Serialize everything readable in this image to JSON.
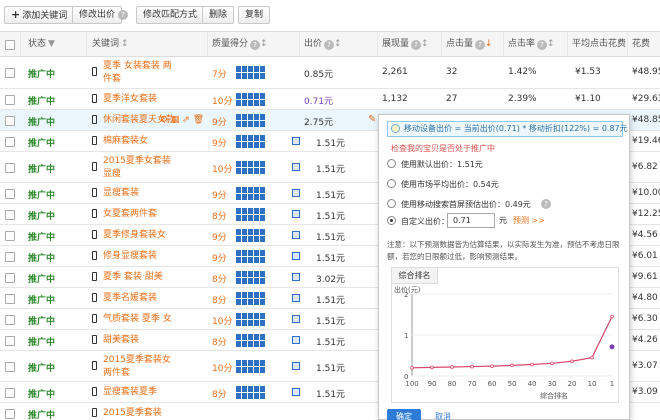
{
  "toolbar": {
    "add_keyword": "添加关键词",
    "modify_bid": "修改出价",
    "modify_match": "修改匹配方式",
    "delete": "删除",
    "copy": "复制"
  },
  "columns": {
    "status": "状态",
    "keyword": "关键词",
    "quality": "质量得分",
    "bid": "出价",
    "impressions": "展现量",
    "clicks": "点击量",
    "ctr": "点击率",
    "avg_cpc": "平均点击花费",
    "cost": "花费"
  },
  "rows": [
    {
      "status": "推广中",
      "keyword": "夏季 女装套装 两件套",
      "score": "7分",
      "bid": "0.85元",
      "impressions": "2,261",
      "clicks": "32",
      "ctr": "1.42%",
      "cpc": "¥1.53",
      "cost": "¥48.95"
    },
    {
      "status": "推广中",
      "keyword": "夏季洋女套装",
      "score": "10分",
      "bid": "0.71元",
      "impressions": "1,132",
      "clicks": "27",
      "ctr": "2.39%",
      "cpc": "¥1.10",
      "cost": "¥29.63"
    },
    {
      "status": "推广中",
      "keyword": "休闲套装夏天女款",
      "score": "9分",
      "bid": "2.75元",
      "impressions": "",
      "clicks": "",
      "ctr": "",
      "cpc": "",
      "cost": "¥48.85"
    },
    {
      "status": "推广中",
      "keyword": "棉麻套装女",
      "score": "9分",
      "bid": "1.51元",
      "impressions": "",
      "clicks": "",
      "ctr": "",
      "cpc": "",
      "cost": "¥19.46"
    },
    {
      "status": "推广中",
      "keyword": "2015夏季女套装显瘦",
      "score": "10分",
      "bid": "1.51元",
      "impressions": "",
      "clicks": "",
      "ctr": "",
      "cpc": "",
      "cost": "¥6.82"
    },
    {
      "status": "推广中",
      "keyword": "显瘦套装",
      "score": "9分",
      "bid": "1.51元",
      "impressions": "",
      "clicks": "",
      "ctr": "",
      "cpc": "",
      "cost": "¥10.00"
    },
    {
      "status": "推广中",
      "keyword": "女夏套两件套",
      "score": "8分",
      "bid": "1.51元",
      "impressions": "",
      "clicks": "",
      "ctr": "",
      "cpc": "",
      "cost": "¥12.25"
    },
    {
      "status": "推广中",
      "keyword": "夏季修身套装女",
      "score": "9分",
      "bid": "1.51元",
      "impressions": "",
      "clicks": "",
      "ctr": "",
      "cpc": "",
      "cost": "¥4.56"
    },
    {
      "status": "推广中",
      "keyword": "修身显瘦套装",
      "score": "9分",
      "bid": "1.51元",
      "impressions": "",
      "clicks": "",
      "ctr": "",
      "cpc": "",
      "cost": "¥6.01"
    },
    {
      "status": "推广中",
      "keyword": "夏季 套装 甜美",
      "score": "8分",
      "bid": "3.02元",
      "impressions": "",
      "clicks": "",
      "ctr": "",
      "cpc": "",
      "cost": "¥9.61"
    },
    {
      "status": "推广中",
      "keyword": "夏季名媛套装",
      "score": "8分",
      "bid": "1.51元",
      "impressions": "",
      "clicks": "",
      "ctr": "",
      "cpc": "",
      "cost": "¥4.80"
    },
    {
      "status": "推广中",
      "keyword": "气质套装 夏季 女",
      "score": "10分",
      "bid": "1.51元",
      "impressions": "",
      "clicks": "",
      "ctr": "",
      "cpc": "",
      "cost": "¥6.30"
    },
    {
      "status": "推广中",
      "keyword": "甜美套装",
      "score": "8分",
      "bid": "1.51元",
      "impressions": "",
      "clicks": "",
      "ctr": "",
      "cpc": "",
      "cost": "¥4.26"
    },
    {
      "status": "推广中",
      "keyword": "2015夏季套装女两件套",
      "score": "10分",
      "bid": "1.51元",
      "impressions": "",
      "clicks": "",
      "ctr": "",
      "cpc": "",
      "cost": "¥3.07"
    },
    {
      "status": "推广中",
      "keyword": "显瘦套装夏季",
      "score": "8分",
      "bid": "1.51元",
      "impressions": "",
      "clicks": "",
      "ctr": "",
      "cpc": "",
      "cost": "¥3.09"
    },
    {
      "status": "推广中",
      "keyword": "2015夏季套装",
      "score": "",
      "bid": "",
      "impressions": "",
      "clicks": "",
      "ctr": "",
      "cpc": "",
      "cost": ""
    }
  ],
  "popup": {
    "formula": "移动设备出价 = 当前出价(0.71) * 移动折扣(122%) = 0.87元",
    "check_link": "检查我的宝贝是否处于推广中",
    "opt_default": "使用默认出价：1.51元",
    "opt_market": "使用市场平均出价：0.54元",
    "opt_mobile": "使用移动搜索首屏预估出价：0.49元",
    "opt_custom": "自定义出价：",
    "custom_value": "0.71",
    "unit": "元",
    "predict": "预测 >>",
    "note": "注意：以下预测数据皆为估算结果，以实际发生为准，预估不考虑日限额，若您的日限额过低，影响预测结果。",
    "tab": "综合排名",
    "ok": "确定",
    "cancel": "取消"
  },
  "chart_data": {
    "type": "line",
    "ylabel": "出价(元)",
    "xlabel": "综合排名",
    "x": [
      100,
      90,
      80,
      70,
      60,
      50,
      40,
      30,
      20,
      10,
      1
    ],
    "y": [
      0.2,
      0.21,
      0.22,
      0.23,
      0.24,
      0.26,
      0.28,
      0.31,
      0.36,
      0.45,
      1.45
    ],
    "highlight_point": {
      "x": 1,
      "y": 0.71
    },
    "ylim": [
      0,
      2
    ],
    "yticks": [
      "0",
      "1",
      "2"
    ],
    "xticks": [
      "100",
      "90",
      "80",
      "70",
      "60",
      "50",
      "40",
      "30",
      "20",
      "10",
      "1"
    ],
    "series_color": "#d9486a",
    "marker_color": "#7a3fb6"
  }
}
